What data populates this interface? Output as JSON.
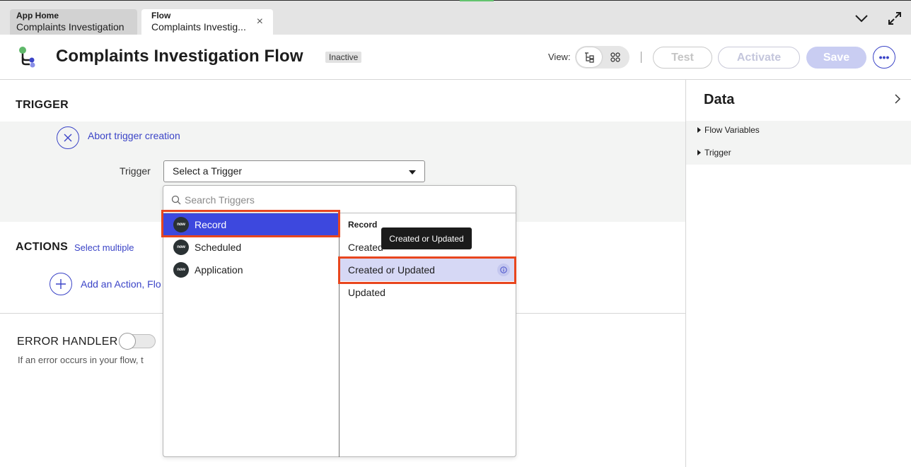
{
  "tabs": [
    {
      "small": "App Home",
      "main": "Complaints Investigation"
    },
    {
      "small": "Flow",
      "main": "Complaints Investig...",
      "close": "×"
    }
  ],
  "header": {
    "title": "Complaints Investigation Flow",
    "status": "Inactive",
    "view_label": "View:",
    "test_label": "Test",
    "activate_label": "Activate",
    "save_label": "Save",
    "more_label": "•••"
  },
  "trigger": {
    "section_title": "TRIGGER",
    "abort_label": "Abort trigger creation",
    "field_label": "Trigger",
    "select_value": "Select a Trigger"
  },
  "actions": {
    "section_title": "ACTIONS",
    "select_multiple": "Select multiple",
    "add_label": "Add an Action, Flo"
  },
  "error_handler": {
    "section_title": "ERROR HANDLER",
    "description": "If an error occurs in your flow, t"
  },
  "data_panel": {
    "title": "Data",
    "items": [
      "Flow Variables",
      "Trigger"
    ]
  },
  "dropdown": {
    "search_placeholder": "Search Triggers",
    "logo_text": "now",
    "categories": [
      "Record",
      "Scheduled",
      "Application"
    ],
    "selected_category": "Record",
    "right_heading": "Record",
    "options": [
      "Created",
      "Created or Updated",
      "Updated"
    ],
    "highlighted_option": "Created or Updated",
    "tooltip": "Created or Updated"
  },
  "colors": {
    "accent": "#3b44c7",
    "selected_bg": "#3d48de",
    "highlight_bg": "#d6d8f5",
    "annotation_frame": "#e8461e"
  }
}
